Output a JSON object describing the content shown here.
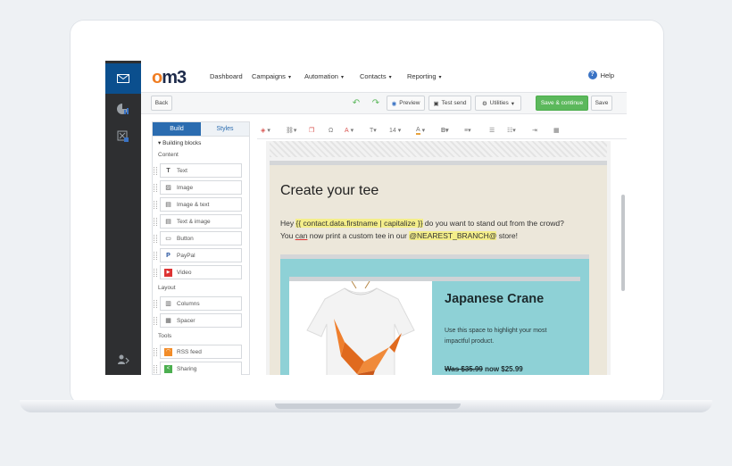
{
  "nav": {
    "logo": "om3",
    "items": [
      {
        "label": "Dashboard",
        "has_caret": false
      },
      {
        "label": "Campaigns",
        "has_caret": true
      },
      {
        "label": "Automation",
        "has_caret": true
      },
      {
        "label": "Contacts",
        "has_caret": true
      },
      {
        "label": "Reporting",
        "has_caret": true
      }
    ],
    "help": "Help"
  },
  "toolbar": {
    "back": "Back",
    "preview": "Preview",
    "test_send": "Test send",
    "utilities": "Utilities",
    "save_continue": "Save & continue",
    "save": "Save"
  },
  "sidebar": {
    "tabs": [
      "Build",
      "Styles"
    ],
    "section": "Building blocks",
    "groups": {
      "content": "Content",
      "layout": "Layout",
      "tools": "Tools"
    },
    "content_blocks": [
      "Text",
      "Image",
      "Image & text",
      "Text & image",
      "Button",
      "PayPal",
      "Video"
    ],
    "layout_blocks": [
      "Columns",
      "Spacer"
    ],
    "tool_blocks": [
      "RSS feed",
      "Sharing"
    ]
  },
  "editor": {
    "font_size": "14",
    "heading": "Create your tee",
    "line1_pre": "Hey ",
    "merge_tag": "{{ contact.data.firstname | capitalize }}",
    "line1_post": " do you want to stand out from the crowd?",
    "line2_pre": "You ",
    "line2_can": "can",
    "line2_mid": " now print a custom tee in our ",
    "branch_tag": "@NEAREST_BRANCH@",
    "line2_post": " store!",
    "product": {
      "title": "Japanese Crane",
      "description": "Use this space to highlight your most impactful product.",
      "old_price": "Was $35.99",
      "new_price": " now $25.99"
    }
  },
  "colors": {
    "accent": "#0b4f8e",
    "save_green": "#5cb85c",
    "promo_bg": "#8ed1d6",
    "card_bg": "#ece7da",
    "merge_highlight": "#f4ee8a",
    "logo_orange": "#f07d22"
  }
}
